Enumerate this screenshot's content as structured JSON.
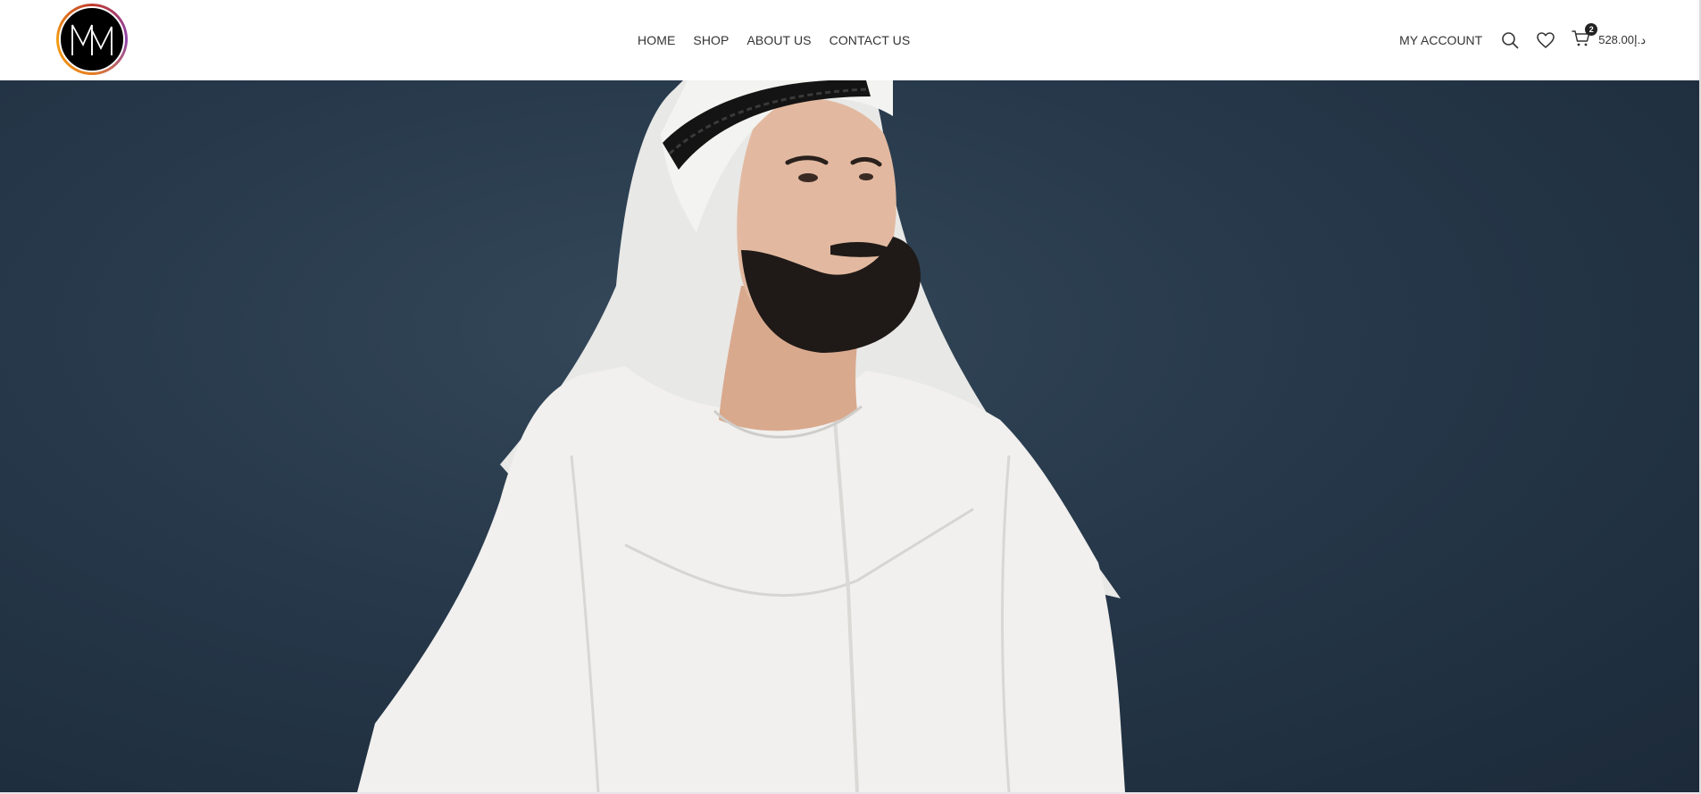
{
  "header": {
    "logo_text": "MM",
    "nav": [
      {
        "label": "HOME"
      },
      {
        "label": "SHOP"
      },
      {
        "label": "ABOUT US"
      },
      {
        "label": "CONTACT US"
      }
    ],
    "account_label": "MY ACCOUNT",
    "search_icon": "search-icon",
    "wishlist_icon": "heart-icon",
    "cart_icon": "cart-icon",
    "cart_count": "2",
    "cart_total": "528.00د.إ"
  },
  "hero": {
    "image_subject": "man in white kandura and ghutra against dark blue background",
    "background_color": "#26384a"
  }
}
